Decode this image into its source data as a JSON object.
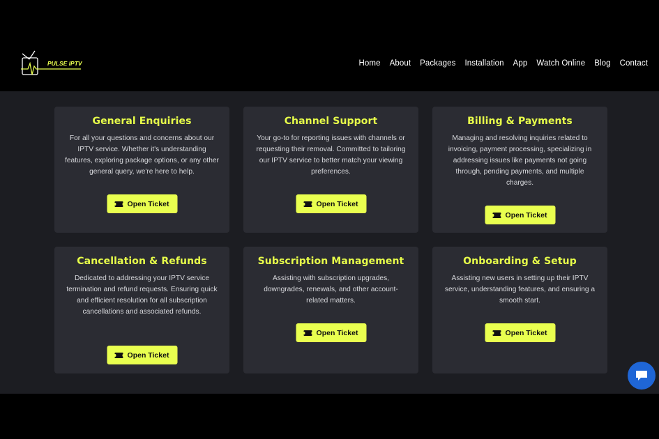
{
  "brand": {
    "logo_text": "PULSE IPTV",
    "accent": "#e9ff4f"
  },
  "nav": [
    "Home",
    "About",
    "Packages",
    "Installation",
    "App",
    "Watch Online",
    "Blog",
    "Contact"
  ],
  "cards": [
    {
      "title": "General Enquiries",
      "text": "For all your questions and concerns about our IPTV service. Whether it's understanding features, exploring package options, or any other general query, we're here to help.",
      "button": "Open Ticket"
    },
    {
      "title": "Channel Support",
      "text": "Your go-to for reporting issues with channels or requesting their removal. Committed to tailoring our IPTV service to better match your viewing preferences.",
      "button": "Open Ticket"
    },
    {
      "title": "Billing & Payments",
      "text": "Managing and resolving inquiries related to invoicing, payment processing, specializing in addressing issues like payments not going through, pending payments, and multiple charges.",
      "button": "Open Ticket"
    },
    {
      "title": "Cancellation & Refunds",
      "text": "Dedicated to addressing your IPTV service termination and refund requests. Ensuring quick and efficient resolution for all subscription cancellations and associated refunds.",
      "button": "Open Ticket"
    },
    {
      "title": "Subscription Management",
      "text": "Assisting with subscription upgrades, downgrades, renewals, and other account-related matters.",
      "button": "Open Ticket"
    },
    {
      "title": "Onboarding & Setup",
      "text": "Assisting new users in setting up their IPTV service, understanding features, and ensuring a smooth start.",
      "button": "Open Ticket"
    }
  ],
  "icons": {
    "ticket": "ticket-icon",
    "chat": "chat-icon"
  }
}
